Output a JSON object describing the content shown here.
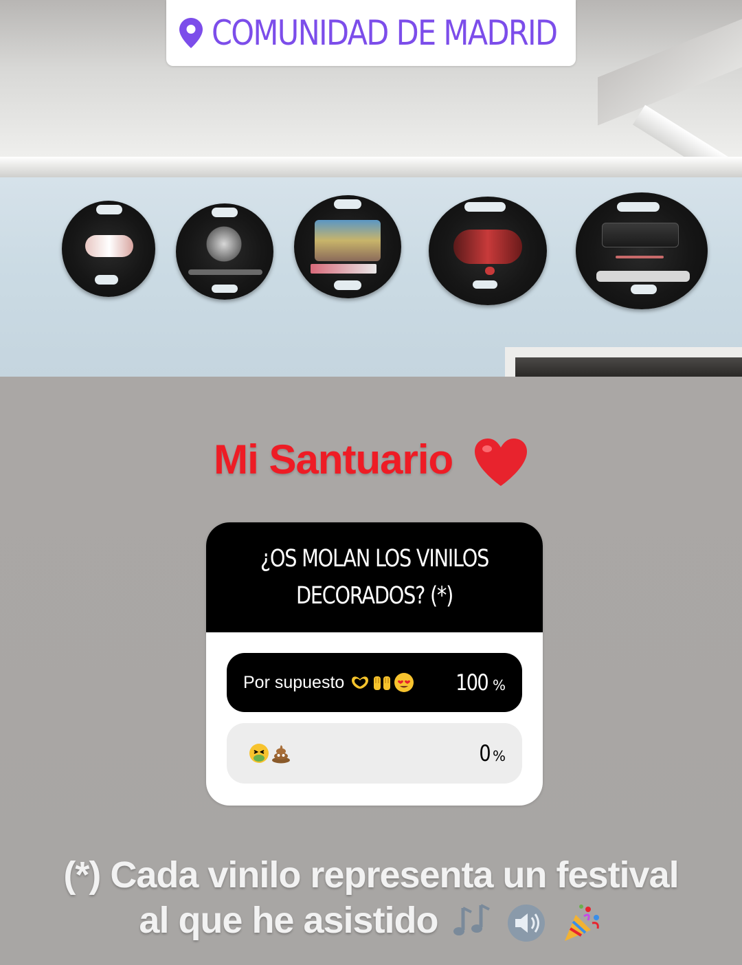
{
  "location_sticker": {
    "icon": "location-pin-icon",
    "label": "COMUNIDAD DE MADRID",
    "color": "#7c4dea"
  },
  "photo": {
    "subject": "vinyl-wall-photo",
    "vinyl_count": 5
  },
  "headline": {
    "text": "Mi Santuario",
    "emoji": "red-heart-icon",
    "color": "#ee1c25"
  },
  "poll": {
    "question": "¿OS MOLAN LOS VINILOS DECORADOS? (*)",
    "options": [
      {
        "label": "Por supuesto",
        "emojis": [
          "heart-hands-icon",
          "raising-hands-icon",
          "heart-eyes-icon"
        ],
        "percent_value": "100",
        "percent_sign": "%",
        "selected": true
      },
      {
        "label": "",
        "emojis": [
          "nauseated-face-icon",
          "poop-icon"
        ],
        "percent_value": "0",
        "percent_sign": "%",
        "selected": false
      }
    ]
  },
  "caption": {
    "line1": "(*) Cada vinilo representa un festival",
    "line2": "al que he asistido",
    "emojis": [
      "music-notes-icon",
      "speaker-icon",
      "party-popper-icon"
    ]
  }
}
